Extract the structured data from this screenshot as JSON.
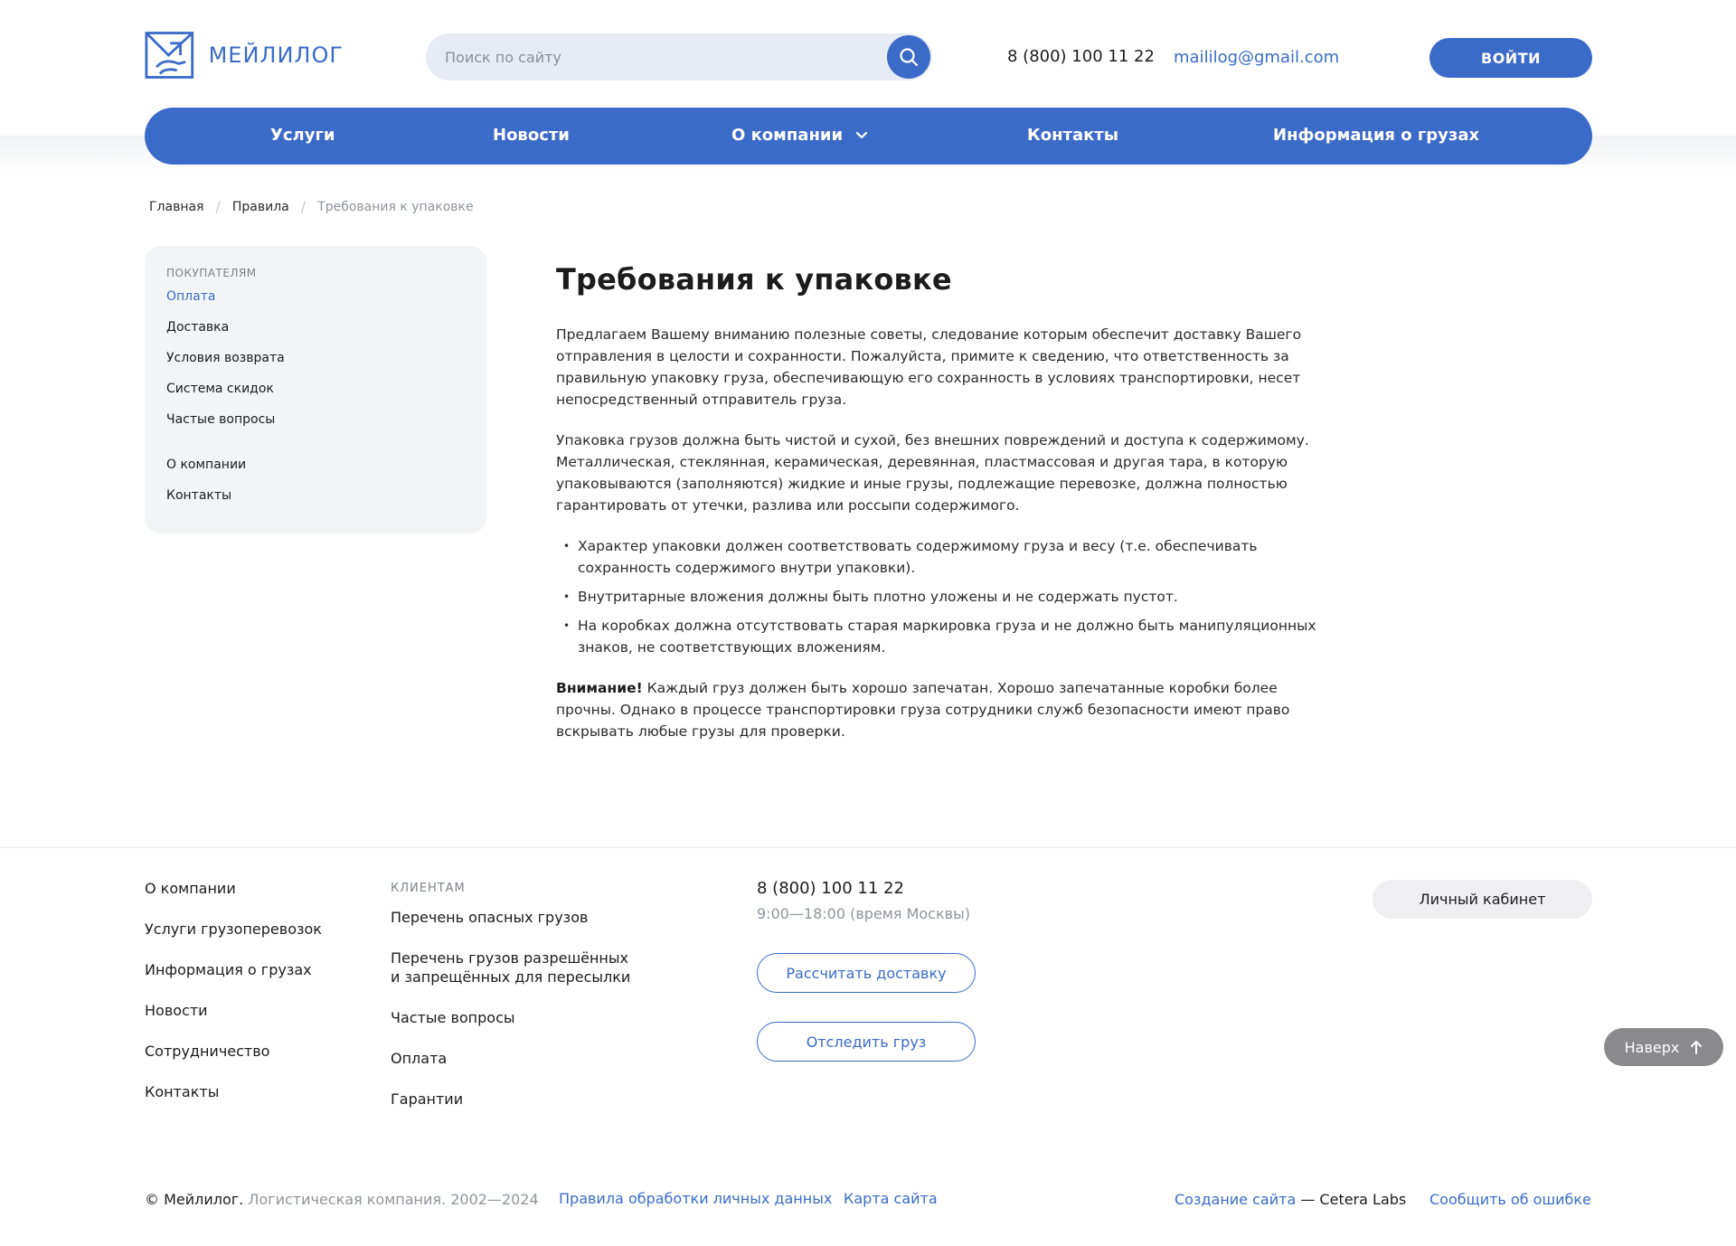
{
  "brand": {
    "logo_text": "МЕЙЛИЛОГ"
  },
  "header": {
    "search_placeholder": "Поиск по сайту",
    "phone": "8 (800) 100 11 22",
    "email": "maililog@gmail.com",
    "login_label": "ВОЙТИ"
  },
  "nav": {
    "items": [
      "Услуги",
      "Новости",
      "О компании",
      "Контакты",
      "Информация о грузах"
    ]
  },
  "breadcrumb": {
    "items": [
      "Главная",
      "Правила",
      "Требования к упаковке"
    ]
  },
  "sidebar": {
    "category": "ПОКУПАТЕЛЯМ",
    "items": [
      "Оплата",
      "Доставка",
      "Условия возврата",
      "Система скидок",
      "Частые вопросы"
    ],
    "extra": [
      "О компании",
      "Контакты"
    ]
  },
  "content": {
    "title": "Требования к упаковке",
    "para1": "Предлагаем Вашему вниманию полезные советы, следование которым  обеспечит доставку Вашего отправления в целости и сохранности.  Пожалуйста, примите к сведению, что ответственность за правильную  упаковку груза, обеспечивающую его сохранность в условиях  транспортировки, несет непосредственный отправитель груза.",
    "para2": "Упаковка грузов должна быть чистой и сухой, без внешних повреждений и доступа к содержимому. Металлическая, стеклянная, керамическая, деревянная, пластмассовая и  другая тара, в которую упаковываются (заполняются) жидкие и иные грузы,  подлежащие перевозке, должна полностью гарантировать от утечки, разлива  или россыпи содержимого.",
    "bullets": [
      "Характер упаковки должен соответствовать содержимому груза и весу (т.е. обеспечивать сохранность содержимого внутри упаковки).",
      "Внутритарные вложения должны быть плотно уложены и не содержать пустот.",
      "На коробках должна отсутствовать старая маркировка груза и не должно быть манипуляционных знаков, не соответствующих вложениям."
    ],
    "attention_label": "Внимание!",
    "attention_text": " Каждый груз должен быть хорошо запечатан. Хорошо запечатанные коробки  более прочны. Однако в процессе транспортировки груза сотрудники служб  безопасности имеют право вскрывать любые грузы для проверки."
  },
  "footer": {
    "col1": [
      "О компании",
      "Услуги грузоперевозок",
      "Информация о грузах",
      "Новости",
      "Сотрудничество",
      "Контакты"
    ],
    "col2_category": "КЛИЕНТАМ",
    "col2": [
      "Перечень опасных грузов",
      "Перечень грузов разрешённых",
      "и запрещённых для пересылки",
      "Частые вопросы",
      "Оплата",
      "Гарантии"
    ],
    "phone": "8 (800) 100 11 22",
    "hours": "9:00—18:00 (время Москвы)",
    "calc_button": "Рассчитать доставку",
    "track_button": "Отследить груз",
    "cabinet_button": "Личный кабинет",
    "top_button": "Наверх",
    "copyright_brand": "© Мейлилог.",
    "copyright_text": " Логистическая компания. 2002—2024",
    "privacy_link": "Правила обработки личных данных",
    "sitemap_link": "Карта сайта",
    "credits_link": "Создание сайта",
    "credits_text": " — Cetera Labs",
    "report_link": "Сообщить об ошибке"
  },
  "colors": {
    "accent": "#3b6bc8",
    "sidebar_bg": "#f3f4f6",
    "muted": "#8f949c"
  }
}
